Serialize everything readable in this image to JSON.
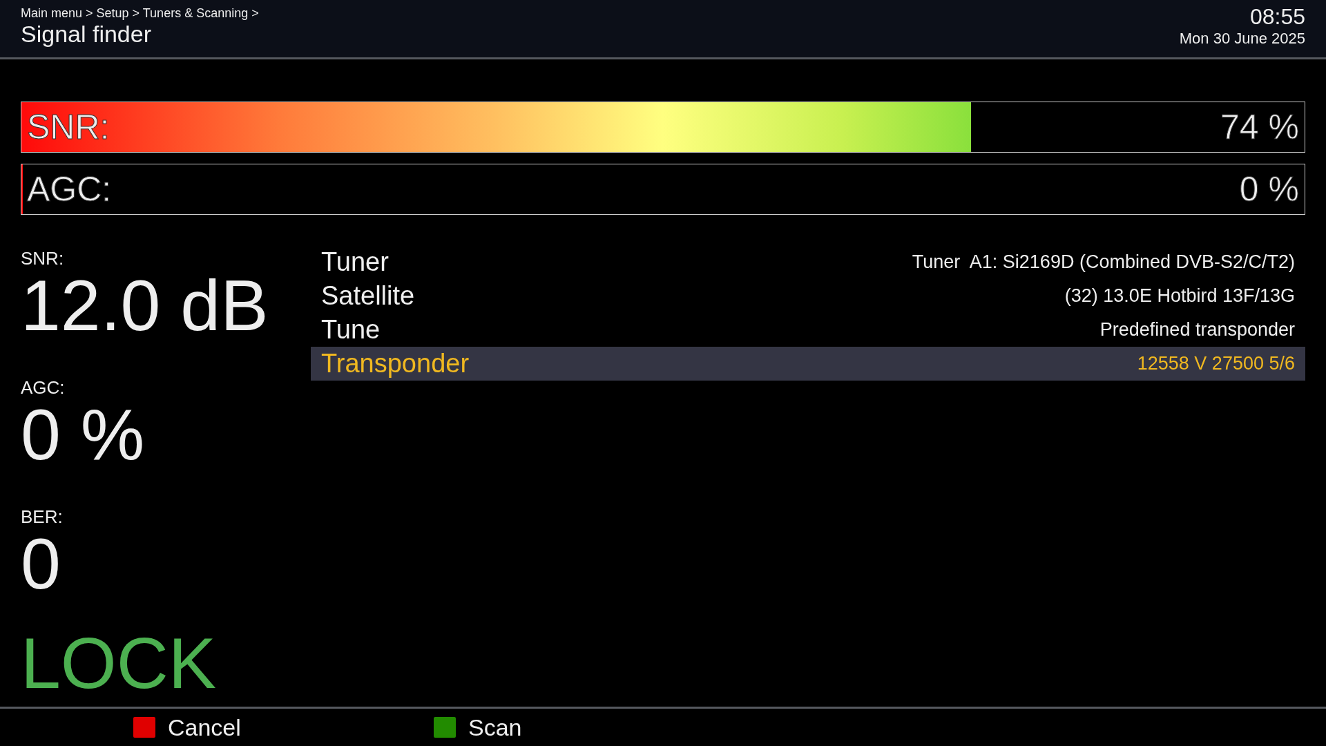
{
  "header": {
    "breadcrumb": "Main menu > Setup > Tuners & Scanning >",
    "title": "Signal finder",
    "time": "08:55",
    "date": "Mon 30 June 2025"
  },
  "meters": [
    {
      "label": "SNR:",
      "level": 0.74,
      "reading": "74 %"
    },
    {
      "label": "AGC:",
      "level": 0,
      "reading": "0 %"
    }
  ],
  "readings": [
    {
      "label": "SNR:",
      "value": "12.0 dB"
    },
    {
      "label": "AGC:",
      "value": "0 %"
    },
    {
      "label": "BER:",
      "value": "0"
    }
  ],
  "lock_status": "LOCK",
  "settings": [
    {
      "label": "Tuner",
      "value": "Tuner  A1: Si2169D (Combined DVB-S2/C/T2)",
      "selected": false
    },
    {
      "label": "Satellite",
      "value": "(32) 13.0E Hotbird 13F/13G",
      "selected": false
    },
    {
      "label": "Tune",
      "value": "Predefined transponder",
      "selected": false
    },
    {
      "label": "Transponder",
      "value": "12558 V 27500 5/6",
      "selected": true
    }
  ],
  "buttons": [
    {
      "label": "Cancel",
      "color": "#e00000"
    },
    {
      "label": "Scan",
      "color": "#228b00"
    }
  ]
}
